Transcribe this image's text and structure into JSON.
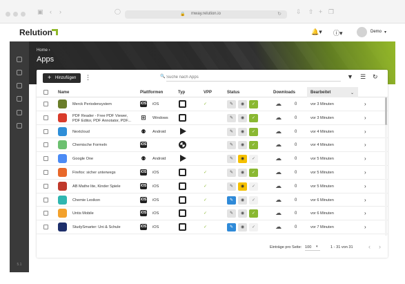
{
  "browser": {
    "url": "mway.relution.io"
  },
  "header": {
    "logo_text": "Relution",
    "user_name": "Demo"
  },
  "sidebar": {
    "version": "5.1"
  },
  "hero": {
    "breadcrumb": "Home ›",
    "title": "Apps"
  },
  "toolbar": {
    "add_label": "Hinzufügen",
    "search_placeholder": "Suche nach Apps"
  },
  "table": {
    "headers": {
      "name": "Name",
      "platforms": "Plattformen",
      "type": "Typ",
      "vpp": "VPP",
      "status": "Status",
      "downloads": "Downloads",
      "edited": "Bearbeitet"
    },
    "rows": [
      {
        "name": "Merck Periodensystem",
        "platform_badge": "iOS",
        "platform": "iOS",
        "type": "ios-store",
        "vpp": true,
        "status": [
          "gray",
          "gray",
          "green"
        ],
        "downloads": "0",
        "edited": "vor 3 Minuten",
        "icon_color": "#6a7d2a"
      },
      {
        "name": "PDF Reader - Free PDF Viewer, PDF Editor, PDF Annotator, PDF...",
        "platform_badge": "⊞",
        "platform": "Windows",
        "type": "windows",
        "vpp": false,
        "status": [
          "gray",
          "gray",
          "green"
        ],
        "downloads": "0",
        "edited": "vor 3 Minuten",
        "icon_color": "#d93b2b"
      },
      {
        "name": "Nextcloud",
        "platform_badge": "⚉",
        "platform": "Android",
        "type": "play",
        "vpp": false,
        "status": [
          "gray",
          "gray",
          "green"
        ],
        "downloads": "0",
        "edited": "vor 4 Minuten",
        "icon_color": "#2e8ed8"
      },
      {
        "name": "Chemische Formeln",
        "platform_badge": "iOS",
        "platform": "",
        "type": "web",
        "vpp": false,
        "status": [
          "gray",
          "gray",
          "green"
        ],
        "downloads": "0",
        "edited": "vor 4 Minuten",
        "icon_color": "#6cc070"
      },
      {
        "name": "Google One",
        "platform_badge": "⚉",
        "platform": "Android",
        "type": "play",
        "vpp": false,
        "status": [
          "gray",
          "yellow",
          "outline"
        ],
        "downloads": "0",
        "edited": "vor 5 Minuten",
        "icon_color": "#4b8bf5"
      },
      {
        "name": "Firefox: sicher unterwegs",
        "platform_badge": "iOS",
        "platform": "iOS",
        "type": "ios-store",
        "vpp": true,
        "status": [
          "gray",
          "gray",
          "green"
        ],
        "downloads": "0",
        "edited": "vor 5 Minuten",
        "icon_color": "#e8682a"
      },
      {
        "name": "AB Mathe lite, Kinder Spiele",
        "platform_badge": "iOS",
        "platform": "iOS",
        "type": "ios-store",
        "vpp": true,
        "status": [
          "gray",
          "yellow",
          "outline"
        ],
        "downloads": "0",
        "edited": "vor 5 Minuten",
        "icon_color": "#c0392b"
      },
      {
        "name": "Chemie Lexikon",
        "platform_badge": "iOS",
        "platform": "iOS",
        "type": "ios-store",
        "vpp": true,
        "status": [
          "blue",
          "gray",
          "outline"
        ],
        "downloads": "0",
        "edited": "vor 6 Minuten",
        "icon_color": "#2fb6b0"
      },
      {
        "name": "Untis Mobile",
        "platform_badge": "iOS",
        "platform": "iOS",
        "type": "ios-store",
        "vpp": true,
        "status": [
          "gray",
          "gray",
          "green"
        ],
        "downloads": "0",
        "edited": "vor 6 Minuten",
        "icon_color": "#f3a12c"
      },
      {
        "name": "StudySmarter: Uni & Schule",
        "platform_badge": "iOS",
        "platform": "iOS",
        "type": "ios-store",
        "vpp": true,
        "status": [
          "blue",
          "gray",
          "outline"
        ],
        "downloads": "0",
        "edited": "vor 7 Minuten",
        "icon_color": "#1d2f6b"
      }
    ]
  },
  "footer": {
    "per_page_label": "Einträge pro Seite:",
    "per_page_value": "100",
    "range": "1 - 31 von 31"
  },
  "colors": {
    "accent": "#8ab832",
    "warning": "#f5c000",
    "info": "#2f8ad8",
    "rail": "#3a3a3a"
  },
  "icons": {
    "status_edit": "✎",
    "status_view": "◉",
    "status_check": "✓",
    "download": "☁",
    "chevron": "›",
    "vpp_check": "✓"
  }
}
